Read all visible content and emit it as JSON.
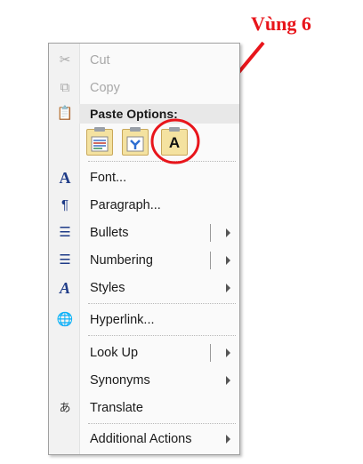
{
  "annotation": {
    "text": "Vùng 6",
    "color": "#e8151b"
  },
  "menu": {
    "items": [
      {
        "label": "Cut",
        "icon": "scissors-icon",
        "disabled": true
      },
      {
        "label": "Copy",
        "icon": "copy-icon",
        "disabled": true
      },
      {
        "label": "Font...",
        "icon": "font-icon"
      },
      {
        "label": "Paragraph...",
        "icon": "paragraph-icon"
      },
      {
        "label": "Bullets",
        "icon": "bullets-icon",
        "split": true
      },
      {
        "label": "Numbering",
        "icon": "numbering-icon",
        "split": true
      },
      {
        "label": "Styles",
        "icon": "styles-icon",
        "submenu": true
      },
      {
        "label": "Hyperlink...",
        "icon": "hyperlink-icon"
      },
      {
        "label": "Look Up",
        "icon": "",
        "split": true
      },
      {
        "label": "Synonyms",
        "icon": "",
        "submenu": true
      },
      {
        "label": "Translate",
        "icon": "translate-icon"
      },
      {
        "label": "Additional Actions",
        "icon": "",
        "submenu": true
      }
    ],
    "paste_options": {
      "header": "Paste Options:",
      "buttons": [
        {
          "name": "keep-source-formatting",
          "icon": "paste-keep-formatting-icon"
        },
        {
          "name": "merge-formatting",
          "icon": "paste-merge-formatting-icon"
        },
        {
          "name": "keep-text-only",
          "icon": "paste-text-only-icon",
          "glyph": "A",
          "highlighted": true
        }
      ]
    }
  }
}
